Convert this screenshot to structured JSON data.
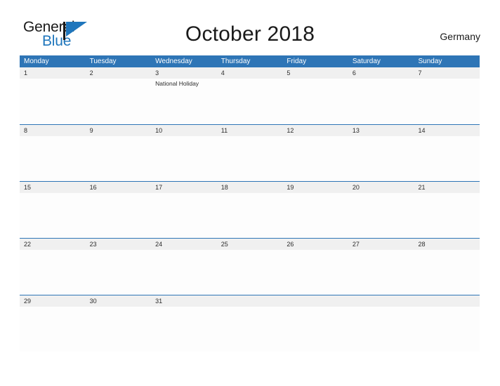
{
  "logo": {
    "word_top": "General",
    "word_bottom": "Blue",
    "icon": "flag-icon",
    "flag_color": "#1f76bc",
    "pole_color": "#1a1a1a"
  },
  "header": {
    "title": "October 2018",
    "country": "Germany"
  },
  "colors": {
    "header_blue": "#2e75b6",
    "row_line_blue": "#2e75b6",
    "date_band_gray": "#f0f0f0",
    "cell_white": "#fdfdfd",
    "text_dark": "#2b2b2b",
    "header_text": "#ffffff",
    "logo_blue": "#1f76bc"
  },
  "weekdays": [
    "Monday",
    "Tuesday",
    "Wednesday",
    "Thursday",
    "Friday",
    "Saturday",
    "Sunday"
  ],
  "weeks": [
    {
      "days": [
        {
          "num": "1",
          "events": []
        },
        {
          "num": "2",
          "events": []
        },
        {
          "num": "3",
          "events": [
            "National Holiday"
          ]
        },
        {
          "num": "4",
          "events": []
        },
        {
          "num": "5",
          "events": []
        },
        {
          "num": "6",
          "events": []
        },
        {
          "num": "7",
          "events": []
        }
      ]
    },
    {
      "days": [
        {
          "num": "8",
          "events": []
        },
        {
          "num": "9",
          "events": []
        },
        {
          "num": "10",
          "events": []
        },
        {
          "num": "11",
          "events": []
        },
        {
          "num": "12",
          "events": []
        },
        {
          "num": "13",
          "events": []
        },
        {
          "num": "14",
          "events": []
        }
      ]
    },
    {
      "days": [
        {
          "num": "15",
          "events": []
        },
        {
          "num": "16",
          "events": []
        },
        {
          "num": "17",
          "events": []
        },
        {
          "num": "18",
          "events": []
        },
        {
          "num": "19",
          "events": []
        },
        {
          "num": "20",
          "events": []
        },
        {
          "num": "21",
          "events": []
        }
      ]
    },
    {
      "days": [
        {
          "num": "22",
          "events": []
        },
        {
          "num": "23",
          "events": []
        },
        {
          "num": "24",
          "events": []
        },
        {
          "num": "25",
          "events": []
        },
        {
          "num": "26",
          "events": []
        },
        {
          "num": "27",
          "events": []
        },
        {
          "num": "28",
          "events": []
        }
      ]
    },
    {
      "days": [
        {
          "num": "29",
          "events": []
        },
        {
          "num": "30",
          "events": []
        },
        {
          "num": "31",
          "events": []
        },
        {
          "num": "",
          "events": []
        },
        {
          "num": "",
          "events": []
        },
        {
          "num": "",
          "events": []
        },
        {
          "num": "",
          "events": []
        }
      ]
    }
  ]
}
